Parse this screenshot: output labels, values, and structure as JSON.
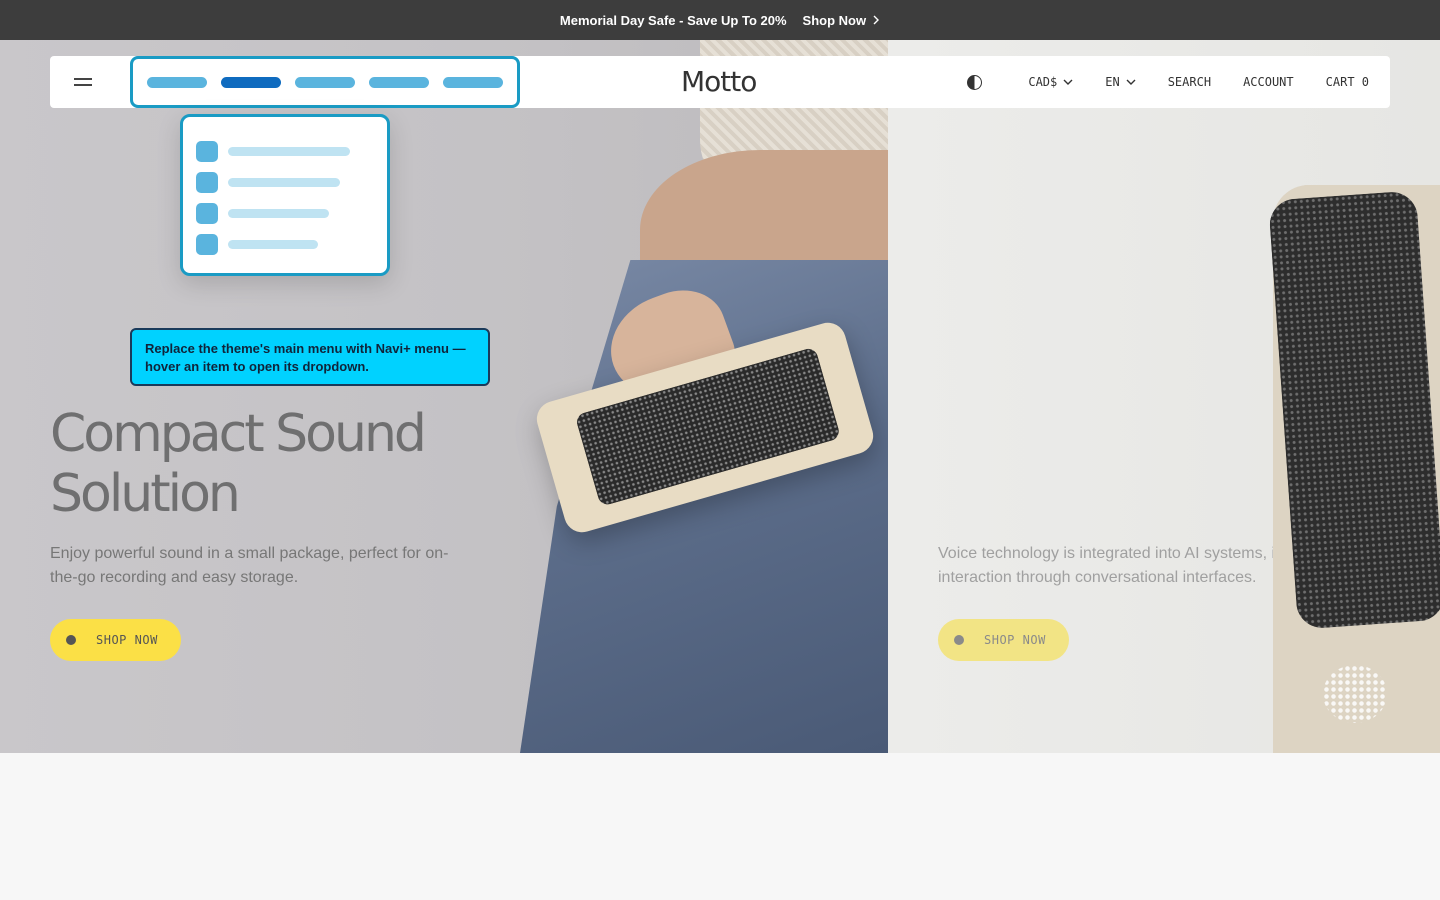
{
  "announcement": {
    "text": "Memorial Day Safe - Save Up To 20%",
    "link_label": "Shop Now",
    "link_icon": "chevron-right-icon"
  },
  "header": {
    "logo": "Motto",
    "menu_icon": "hamburger-icon",
    "theme_toggle_icon": "contrast-icon",
    "currency": "CAD$",
    "language": "EN",
    "search_label": "SEARCH",
    "account_label": "ACCOUNT",
    "cart_label": "CART 0"
  },
  "navi_plus": {
    "menu_items_count": 5,
    "active_index": 1,
    "dropdown_items_count": 4,
    "colors": {
      "border": "#1a9bc4",
      "pill": "#5ab4de",
      "pill_active": "#0f6bbf",
      "line": "#bfe3f2"
    },
    "tooltip": "Replace the theme's main menu with Navi+ menu — hover an item to open its dropdown."
  },
  "hero": {
    "slides": [
      {
        "title_line1": "Compact Sound",
        "title_line2": "Solution",
        "subtitle": "Enjoy powerful sound in a small package, perfect for on-the-go recording and easy storage.",
        "button_label": "SHOP NOW"
      },
      {
        "subtitle": "Voice technology is integrated into AI systems, improving interaction through conversational interfaces.",
        "button_label": "SHOP NOW"
      }
    ],
    "button_color": "#fbe046"
  }
}
